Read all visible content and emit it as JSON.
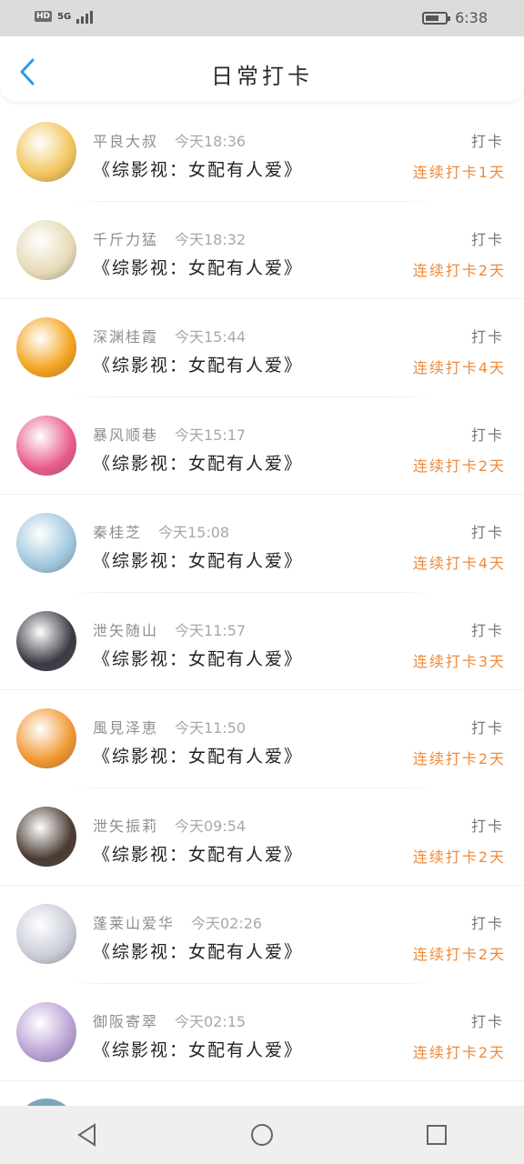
{
  "status_bar": {
    "network": "5G",
    "hd": "HD",
    "time": "6:38",
    "battery_level": 0.7
  },
  "header": {
    "title": "日常打卡",
    "back_icon": "chevron-left-icon"
  },
  "checkins": [
    {
      "user": "平良大叔",
      "time": "今天18:36",
      "book": "《综影视：女配有人爱》",
      "label": "打卡",
      "streak": "连续打卡1天",
      "avatar_color": "#f2c45a"
    },
    {
      "user": "千斤力猛",
      "time": "今天18:32",
      "book": "《综影视：女配有人爱》",
      "label": "打卡",
      "streak": "连续打卡2天",
      "avatar_color": "#e6d9b5"
    },
    {
      "user": "深渊桂霞",
      "time": "今天15:44",
      "book": "《综影视：女配有人爱》",
      "label": "打卡",
      "streak": "连续打卡4天",
      "avatar_color": "#f4a21c"
    },
    {
      "user": "暴风顺巷",
      "time": "今天15:17",
      "book": "《综影视：女配有人爱》",
      "label": "打卡",
      "streak": "连续打卡2天",
      "avatar_color": "#e85b8a"
    },
    {
      "user": "秦桂芝",
      "time": "今天15:08",
      "book": "《综影视：女配有人爱》",
      "label": "打卡",
      "streak": "连续打卡4天",
      "avatar_color": "#9fc7dd"
    },
    {
      "user": "泄矢随山",
      "time": "今天11:57",
      "book": "《综影视：女配有人爱》",
      "label": "打卡",
      "streak": "连续打卡3天",
      "avatar_color": "#3a3a44"
    },
    {
      "user": "風見泽恵",
      "time": "今天11:50",
      "book": "《综影视：女配有人爱》",
      "label": "打卡",
      "streak": "连续打卡2天",
      "avatar_color": "#f0962e"
    },
    {
      "user": "泄矢振莉",
      "time": "今天09:54",
      "book": "《综影视：女配有人爱》",
      "label": "打卡",
      "streak": "连续打卡2天",
      "avatar_color": "#4a3a32"
    },
    {
      "user": "蓬莱山爱华",
      "time": "今天02:26",
      "book": "《综影视：女配有人爱》",
      "label": "打卡",
      "streak": "连续打卡2天",
      "avatar_color": "#c9ccd8"
    },
    {
      "user": "御阪寄翠",
      "time": "今天02:15",
      "book": "《综影视：女配有人爱》",
      "label": "打卡",
      "streak": "连续打卡2天",
      "avatar_color": "#b8a0d4"
    }
  ],
  "nav": {
    "back": "triangle-back-icon",
    "home": "circle-home-icon",
    "recent": "square-recent-icon"
  },
  "colors": {
    "accent_blue": "#2f9be0",
    "streak_orange": "#ee8a3a"
  }
}
